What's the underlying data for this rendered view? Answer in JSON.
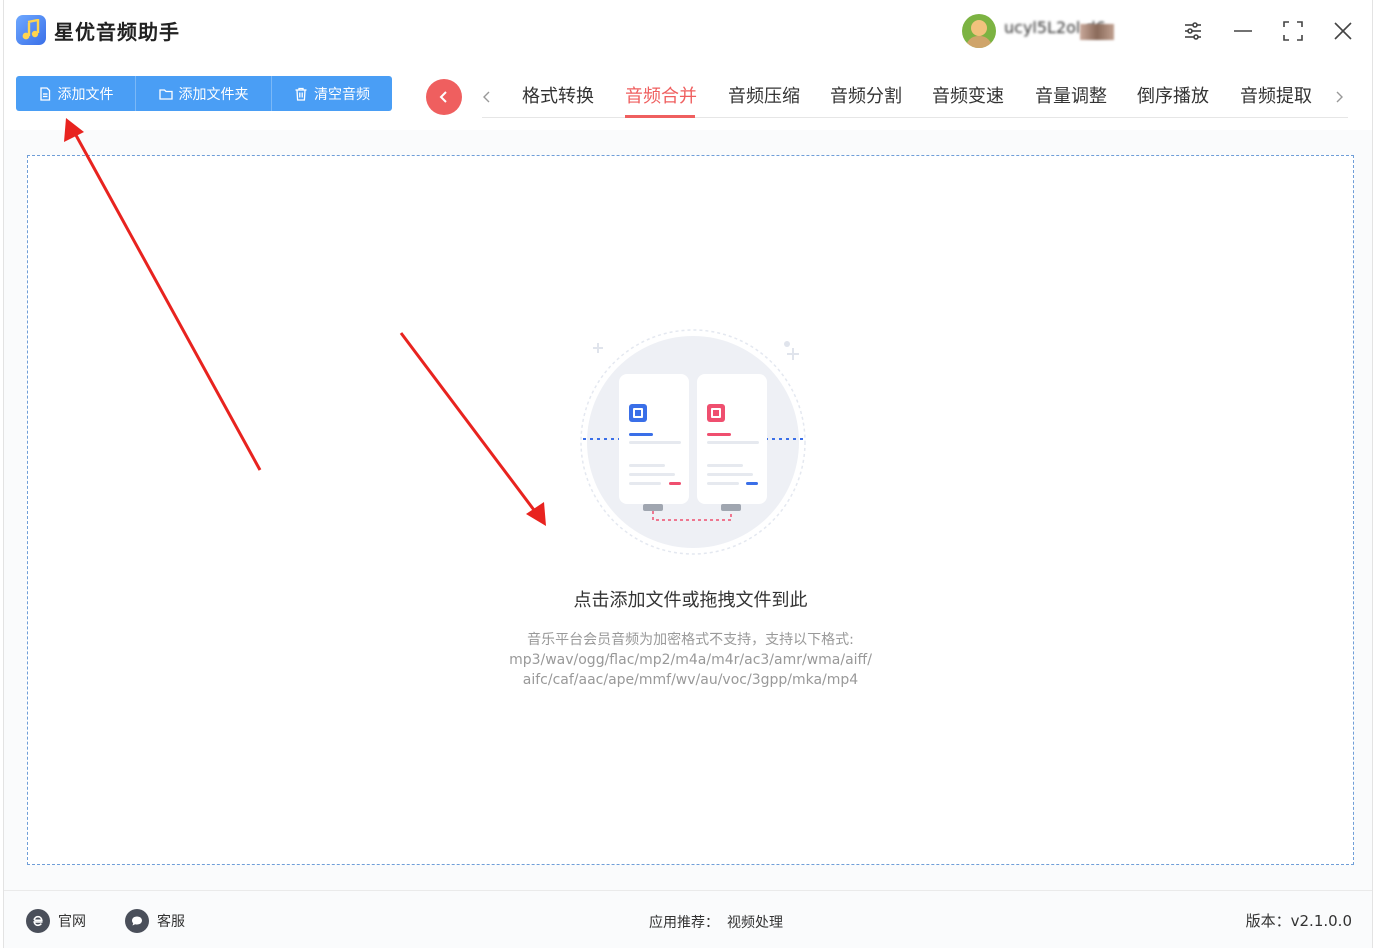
{
  "app": {
    "title": "星优音频助手",
    "username": "ucyl5L2ol.d6"
  },
  "toolbar": {
    "add_file": "添加文件",
    "add_folder": "添加文件夹",
    "clear_audio": "清空音频"
  },
  "tabs": [
    {
      "label": "格式转换"
    },
    {
      "label": "音频合并",
      "active": true
    },
    {
      "label": "音频压缩"
    },
    {
      "label": "音频分割"
    },
    {
      "label": "音频变速"
    },
    {
      "label": "音量调整"
    },
    {
      "label": "倒序播放"
    },
    {
      "label": "音频提取"
    }
  ],
  "dropzone": {
    "title": "点击添加文件或拖拽文件到此",
    "desc_line1": "音乐平台会员音频为加密格式不支持，支持以下格式:",
    "desc_line2": "mp3/wav/ogg/flac/mp2/m4a/m4r/ac3/amr/wma/aiff/",
    "desc_line3": "aifc/caf/aac/ape/mmf/wv/au/voc/3gpp/mka/mp4"
  },
  "footer": {
    "website": "官网",
    "support": "客服",
    "recommend_label": "应用推荐：",
    "recommend_value": "视频处理",
    "version": "版本：v2.1.0.0"
  },
  "colors": {
    "accent_blue": "#4a9ef5",
    "accent_red": "#ef5f5f",
    "annotation_arrow": "#e8231f"
  },
  "icons": {
    "settings": "sliders-icon",
    "minimize": "minimize-icon",
    "maximize": "maximize-icon",
    "close": "close-icon"
  }
}
